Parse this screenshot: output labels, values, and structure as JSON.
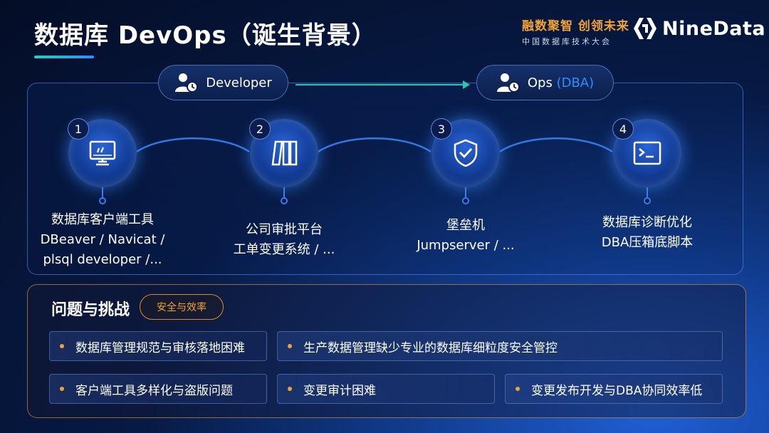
{
  "header": {
    "title": "数据库 DevOps（诞生背景）",
    "brand_slogan": "融数聚智 创领未来",
    "brand_conference": "中国数据库技术大会",
    "logo_text": "NineData"
  },
  "roles": {
    "developer": "Developer",
    "ops": "Ops",
    "ops_suffix": "(DBA)"
  },
  "steps": [
    {
      "number": "1",
      "icon": "monitor-icon",
      "lines": [
        "数据库客户端工具",
        "DBeaver / Navicat /",
        "plsql developer /..."
      ]
    },
    {
      "number": "2",
      "icon": "book-binder-icon",
      "lines": [
        "公司审批平台",
        "工单变更系统 / ..."
      ]
    },
    {
      "number": "3",
      "icon": "shield-check-icon",
      "lines": [
        "堡垒机",
        "Jumpserver / ..."
      ]
    },
    {
      "number": "4",
      "icon": "terminal-icon",
      "lines": [
        "数据库诊断优化",
        "DBA压箱底脚本"
      ]
    }
  ],
  "issues": {
    "title": "问题与挑战",
    "tag": "安全与效率",
    "items": [
      "数据库管理规范与审核落地困难",
      "生产数据管理缺少专业的数据库细粒度安全管控",
      "客户端工具多样化与盗版问题",
      "变更审计困难",
      "变更发布开发与DBA协同效率低"
    ]
  },
  "colors": {
    "accent_orange": "#f0a233",
    "accent_teal": "#28c7b0",
    "accent_blue": "#2f8cff",
    "background": "#071a45"
  }
}
